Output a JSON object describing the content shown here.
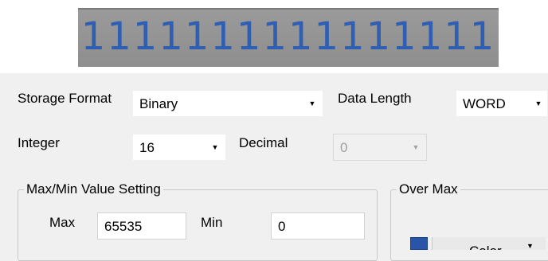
{
  "display": {
    "value": "1111111111111111"
  },
  "storage_format": {
    "label": "Storage Format",
    "value": "Binary"
  },
  "data_length": {
    "label": "Data Length",
    "value": "WORD"
  },
  "integer": {
    "label": "Integer",
    "value": "16"
  },
  "decimal": {
    "label": "Decimal",
    "value": "0"
  },
  "max_min": {
    "title": "Max/Min Value Setting",
    "max_label": "Max",
    "max_value": "65535",
    "min_label": "Min",
    "min_value": "0"
  },
  "over_max": {
    "title": "Over Max",
    "color_label": "Color",
    "swatch_color": "#2855a8"
  },
  "icons": {
    "dropdown": "chevron-down-icon"
  }
}
